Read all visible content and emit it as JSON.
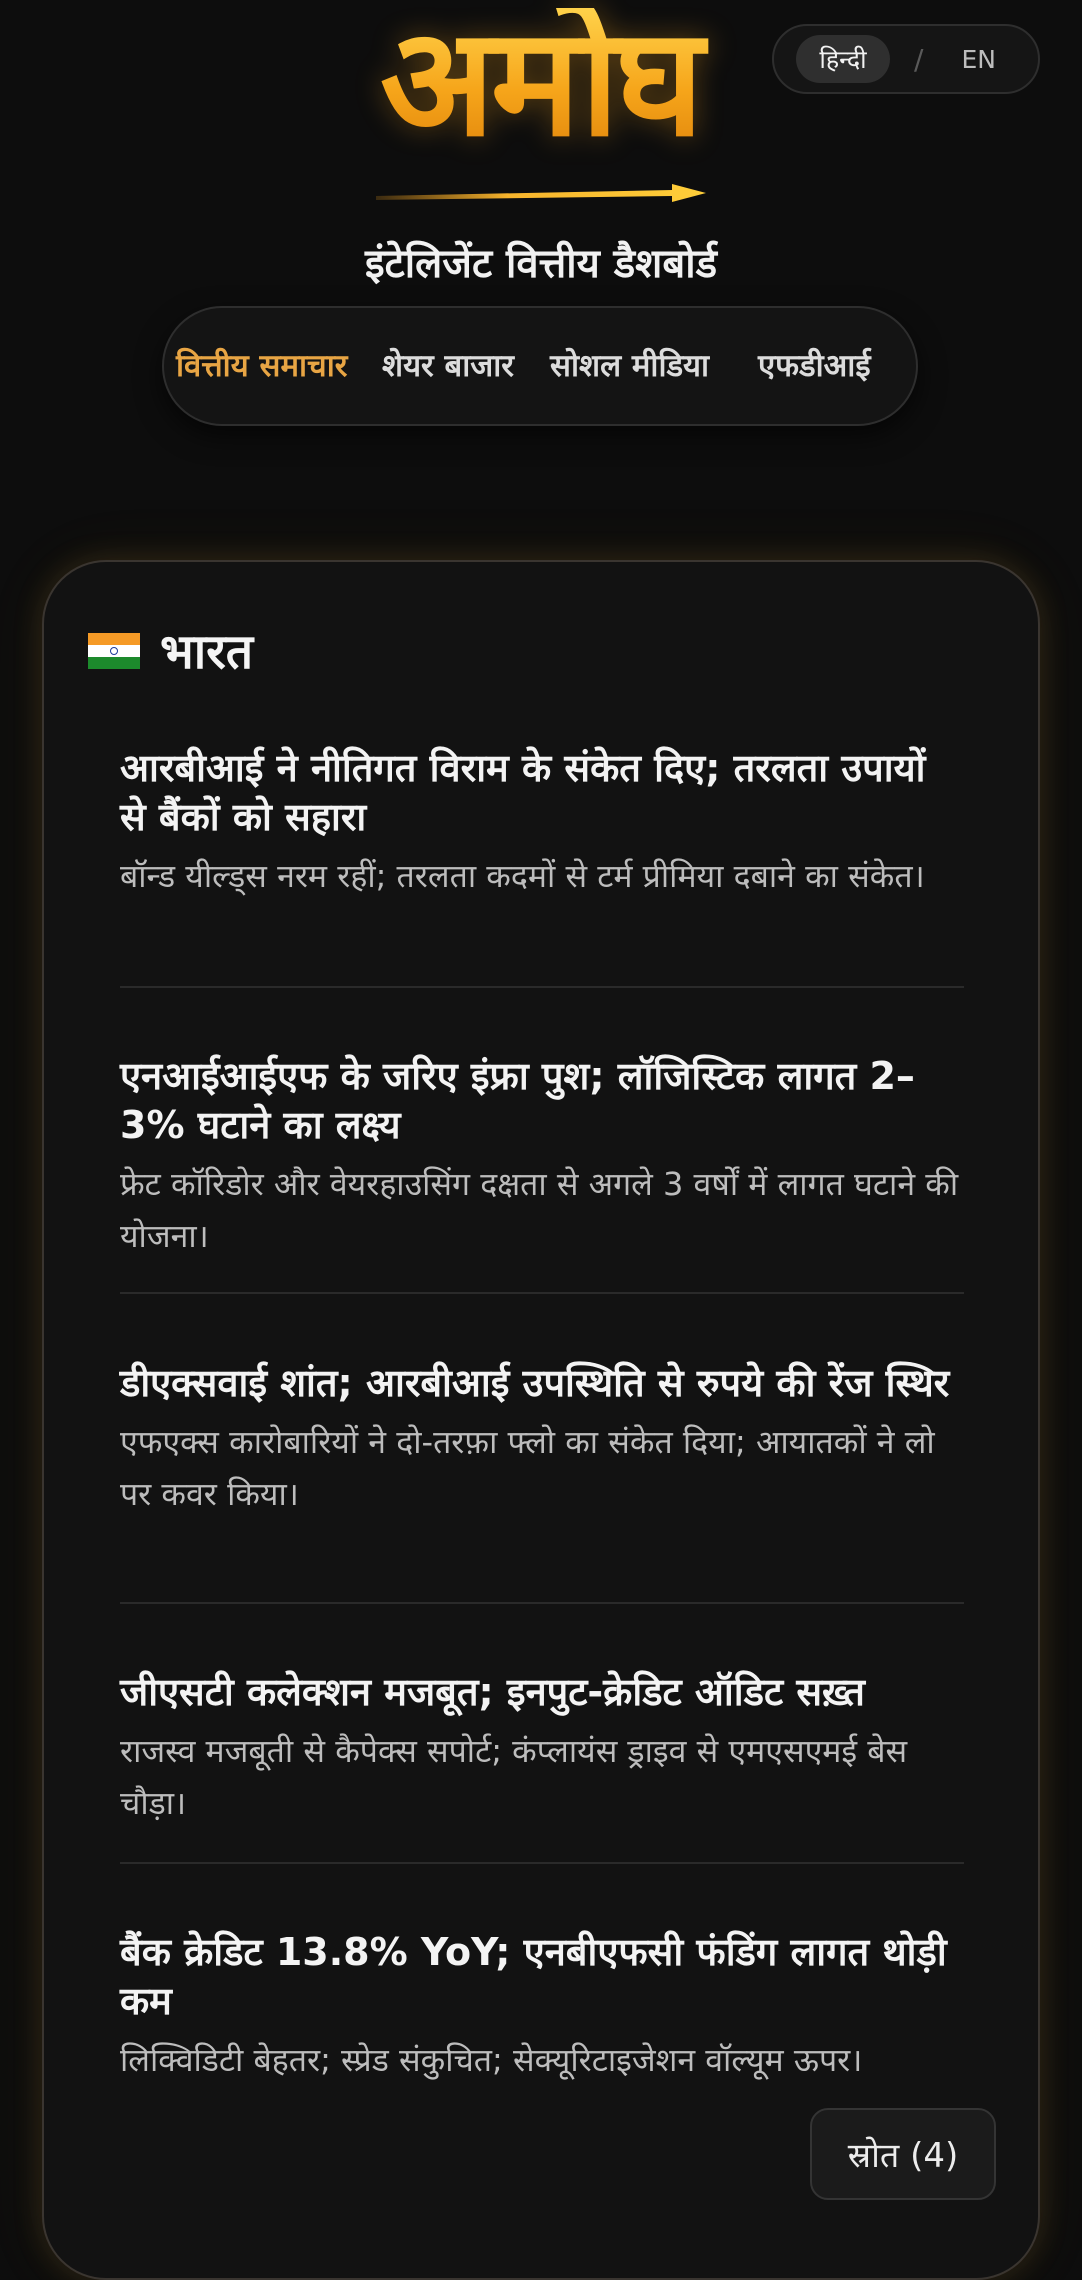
{
  "language_toggle": {
    "hindi_label": "हिन्दी",
    "separator": "/",
    "english_label": "EN",
    "selected": "हिन्दी"
  },
  "brand": {
    "logo_text": "अमोघ",
    "subtitle": "इंटेलिजेंट वित्तीय डैशबोर्ड",
    "accent_color": "#f6a51a"
  },
  "nav": {
    "tabs": [
      {
        "label": "वित्तीय समाचार",
        "active": true
      },
      {
        "label": "शेयर बाजार",
        "active": false
      },
      {
        "label": "सोशल मीडिया",
        "active": false
      },
      {
        "label": "एफडीआई",
        "active": false
      }
    ],
    "active_color": "#e8a544"
  },
  "region": {
    "flag_icon": "india-flag-icon",
    "name": "भारत"
  },
  "news": [
    {
      "title": "आरबीआई ने नीतिगत विराम के संकेत दिए; तरलता उपायों से बैंकों को सहारा",
      "summary": "बॉन्ड यील्ड्स नरम रहीं; तरलता कदमों से टर्म प्रीमिया दबाने का संकेत।"
    },
    {
      "title": "एनआईआईएफ के जरिए इंफ्रा पुश; लॉजिस्टिक लागत 2–3% घटाने का लक्ष्य",
      "summary": "फ्रेट कॉरिडोर और वेयरहाउसिंग दक्षता से अगले 3 वर्षों में लागत घटाने की योजना।"
    },
    {
      "title": "डीएक्सवाई शांत; आरबीआई उपस्थिति से रुपये की रेंज स्थिर",
      "summary": "एफएक्स कारोबारियों ने दो-तरफ़ा फ्लो का संकेत दिया; आयातकों ने लो पर कवर किया।"
    },
    {
      "title": "जीएसटी कलेक्शन मजबूत; इनपुट-क्रेडिट ऑडिट सख़्त",
      "summary": "राजस्व मजबूती से कैपेक्स सपोर्ट; कंप्लायंस ड्राइव से एमएसएमई बेस चौड़ा।"
    },
    {
      "title": "बैंक क्रेडिट 13.8% YoY; एनबीएफसी फंडिंग लागत थोड़ी कम",
      "summary": "लिक्विडिटी बेहतर; स्प्रेड संकुचित; सेक्यूरिटाइजेशन वॉल्यूम ऊपर।"
    }
  ],
  "sources_button": {
    "label": "स्रोत (4)"
  }
}
